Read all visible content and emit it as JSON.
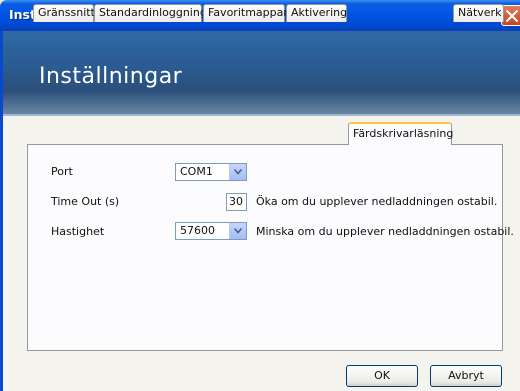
{
  "window": {
    "title": "Inställningar"
  },
  "header": {
    "title": "Inställningar"
  },
  "tabs": [
    {
      "label": "Gränssnitt"
    },
    {
      "label": "Standardinloggning"
    },
    {
      "label": "Favoritmappar"
    },
    {
      "label": "Aktivering"
    },
    {
      "label": "Färdskrivarläsning"
    },
    {
      "label": "Nätverk"
    }
  ],
  "active_tab": "Färdskrivarläsning",
  "form": {
    "port_label": "Port",
    "port_value": "COM1",
    "timeout_label": "Time Out (s)",
    "timeout_value": "30",
    "timeout_hint": "Öka om du upplever nedladdningen ostabil.",
    "speed_label": "Hastighet",
    "speed_value": "57600",
    "speed_hint": "Minska om du upplever nedladdningen ostabil."
  },
  "buttons": {
    "ok": "OK",
    "cancel": "Avbryt"
  },
  "colors": {
    "titlebar": "#0053e3",
    "header": "#2a5a90",
    "active_tab_accent": "#ffc83c"
  },
  "icons": {
    "close": "close-icon",
    "dropdown": "chevron-down-icon"
  }
}
